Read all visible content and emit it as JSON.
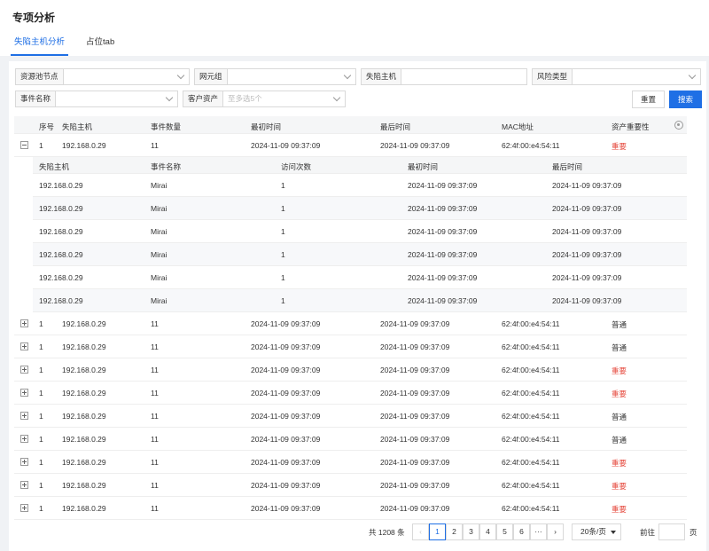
{
  "page": {
    "title": "专项分析"
  },
  "tabs": [
    {
      "label": "失陷主机分析",
      "active": true
    },
    {
      "label": "占位tab",
      "active": false
    }
  ],
  "filters": {
    "resource_pool": {
      "label": "资源池节点",
      "value": ""
    },
    "ne_group": {
      "label": "网元组",
      "value": ""
    },
    "lost_host": {
      "label": "失陷主机",
      "value": ""
    },
    "risk_type": {
      "label": "风险类型",
      "value": ""
    },
    "event_name": {
      "label": "事件名称",
      "value": ""
    },
    "customer_asset": {
      "label": "客户资产",
      "placeholder": "至多选5个"
    }
  },
  "buttons": {
    "reset": "重置",
    "search": "搜索"
  },
  "table": {
    "columns": [
      "序号",
      "失陷主机",
      "事件数量",
      "最初时间",
      "最后时间",
      "MAC地址",
      "资产重要性"
    ],
    "rows": [
      {
        "expanded": true,
        "idx": "1",
        "host": "192.168.0.29",
        "count": "11",
        "first": "2024-11-09 09:37:09",
        "last": "2024-11-09 09:37:09",
        "mac": "62:4f:00:e4:54:11",
        "importance": "重要",
        "level": "high"
      },
      {
        "expanded": false,
        "idx": "1",
        "host": "192.168.0.29",
        "count": "11",
        "first": "2024-11-09 09:37:09",
        "last": "2024-11-09 09:37:09",
        "mac": "62:4f:00:e4:54:11",
        "importance": "普通",
        "level": "normal"
      },
      {
        "expanded": false,
        "idx": "1",
        "host": "192.168.0.29",
        "count": "11",
        "first": "2024-11-09 09:37:09",
        "last": "2024-11-09 09:37:09",
        "mac": "62:4f:00:e4:54:11",
        "importance": "普通",
        "level": "normal"
      },
      {
        "expanded": false,
        "idx": "1",
        "host": "192.168.0.29",
        "count": "11",
        "first": "2024-11-09 09:37:09",
        "last": "2024-11-09 09:37:09",
        "mac": "62:4f:00:e4:54:11",
        "importance": "重要",
        "level": "high"
      },
      {
        "expanded": false,
        "idx": "1",
        "host": "192.168.0.29",
        "count": "11",
        "first": "2024-11-09 09:37:09",
        "last": "2024-11-09 09:37:09",
        "mac": "62:4f:00:e4:54:11",
        "importance": "重要",
        "level": "high"
      },
      {
        "expanded": false,
        "idx": "1",
        "host": "192.168.0.29",
        "count": "11",
        "first": "2024-11-09 09:37:09",
        "last": "2024-11-09 09:37:09",
        "mac": "62:4f:00:e4:54:11",
        "importance": "普通",
        "level": "normal"
      },
      {
        "expanded": false,
        "idx": "1",
        "host": "192.168.0.29",
        "count": "11",
        "first": "2024-11-09 09:37:09",
        "last": "2024-11-09 09:37:09",
        "mac": "62:4f:00:e4:54:11",
        "importance": "普通",
        "level": "normal"
      },
      {
        "expanded": false,
        "idx": "1",
        "host": "192.168.0.29",
        "count": "11",
        "first": "2024-11-09 09:37:09",
        "last": "2024-11-09 09:37:09",
        "mac": "62:4f:00:e4:54:11",
        "importance": "重要",
        "level": "high"
      },
      {
        "expanded": false,
        "idx": "1",
        "host": "192.168.0.29",
        "count": "11",
        "first": "2024-11-09 09:37:09",
        "last": "2024-11-09 09:37:09",
        "mac": "62:4f:00:e4:54:11",
        "importance": "重要",
        "level": "high"
      },
      {
        "expanded": false,
        "idx": "1",
        "host": "192.168.0.29",
        "count": "11",
        "first": "2024-11-09 09:37:09",
        "last": "2024-11-09 09:37:09",
        "mac": "62:4f:00:e4:54:11",
        "importance": "重要",
        "level": "high"
      }
    ],
    "sub_columns": [
      "失陷主机",
      "事件名称",
      "访问次数",
      "最初时间",
      "最后时间"
    ],
    "sub_rows": [
      {
        "host": "192.168.0.29",
        "event": "Mirai",
        "visits": "1",
        "first": "2024-11-09 09:37:09",
        "last": "2024-11-09 09:37:09"
      },
      {
        "host": "192.168.0.29",
        "event": "Mirai",
        "visits": "1",
        "first": "2024-11-09 09:37:09",
        "last": "2024-11-09 09:37:09"
      },
      {
        "host": "192.168.0.29",
        "event": "Mirai",
        "visits": "1",
        "first": "2024-11-09 09:37:09",
        "last": "2024-11-09 09:37:09"
      },
      {
        "host": "192.168.0.29",
        "event": "Mirai",
        "visits": "1",
        "first": "2024-11-09 09:37:09",
        "last": "2024-11-09 09:37:09"
      },
      {
        "host": "192.168.0.29",
        "event": "Mirai",
        "visits": "1",
        "first": "2024-11-09 09:37:09",
        "last": "2024-11-09 09:37:09"
      },
      {
        "host": "192.168.0.29",
        "event": "Mirai",
        "visits": "1",
        "first": "2024-11-09 09:37:09",
        "last": "2024-11-09 09:37:09"
      }
    ]
  },
  "pagination": {
    "total": "共 1208 条",
    "pages": [
      "1",
      "2",
      "3",
      "4",
      "5",
      "6",
      "···"
    ],
    "current": "1",
    "prev": "‹",
    "next": "›",
    "page_size": "20条/页",
    "goto_label": "前往",
    "goto_unit": "页"
  },
  "colors": {
    "accent": "#1f6fe5",
    "important": "#e5463a"
  },
  "icons": {
    "settings": "gear-icon",
    "expand": "plus-square-icon",
    "collapse": "minus-square-icon",
    "dropdown": "chevron-down-icon"
  }
}
